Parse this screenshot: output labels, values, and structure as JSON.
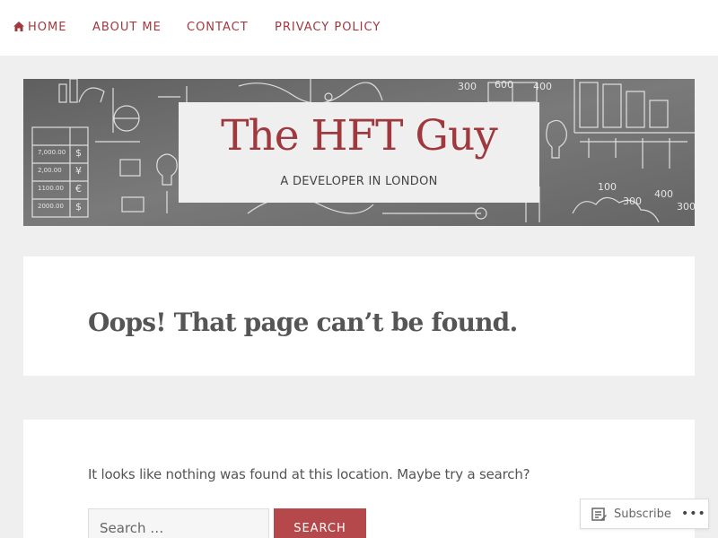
{
  "nav": {
    "items": [
      {
        "label": "HOME",
        "icon": "home-icon"
      },
      {
        "label": "ABOUT ME"
      },
      {
        "label": "CONTACT"
      },
      {
        "label": "PRIVACY POLICY"
      }
    ]
  },
  "header": {
    "site_title": "The HFT Guy",
    "site_description": "A DEVELOPER IN LONDON",
    "banner_doodles": [
      "300",
      "600",
      "400",
      "100",
      "300",
      "400",
      "300",
      "7,000.00",
      "2,00.00",
      "1100.00",
      "2000.00",
      "$",
      "¥",
      "€",
      "$"
    ]
  },
  "main": {
    "page_title": "Oops! That page can’t be found.",
    "not_found_text": "It looks like nothing was found at this location. Maybe try a search?",
    "search": {
      "placeholder": "Search …",
      "value": "",
      "button_label": "SEARCH"
    }
  },
  "subscribe": {
    "label": "Subscribe",
    "more_label": "•••",
    "icon": "reader-icon"
  },
  "colors": {
    "accent": "#a0393e",
    "button": "#b5484b",
    "background": "#efefef",
    "card": "#ffffff"
  }
}
